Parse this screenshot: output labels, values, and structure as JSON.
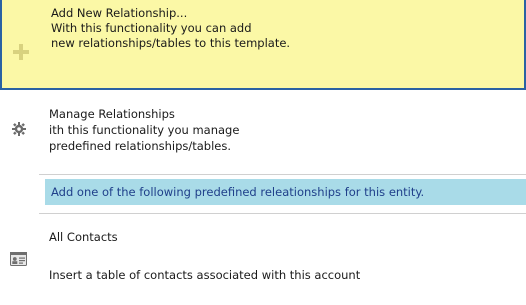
{
  "add_relationship": {
    "title": "Add New Relationship...",
    "line1": "With this functionality you can add",
    "line2": "new relationships/tables to this template.",
    "icon": "plus-icon"
  },
  "manage_relationships": {
    "title": "Manage Relationships",
    "line1": "ith this functionality you manage",
    "line2": "predefined relationships/tables.",
    "icon": "gear-icon"
  },
  "predefined_banner": {
    "text": "Add one of the following predefined releationships for this entity."
  },
  "all_contacts": {
    "title": "All Contacts",
    "description": "Insert a table of contacts associated with this account",
    "icon": "contact-card-icon"
  },
  "colors": {
    "highlight": "#fbf8a6",
    "selection_border": "#2a62a3",
    "banner_bg": "#a9dbe8",
    "banner_text": "#1f3f8a"
  }
}
